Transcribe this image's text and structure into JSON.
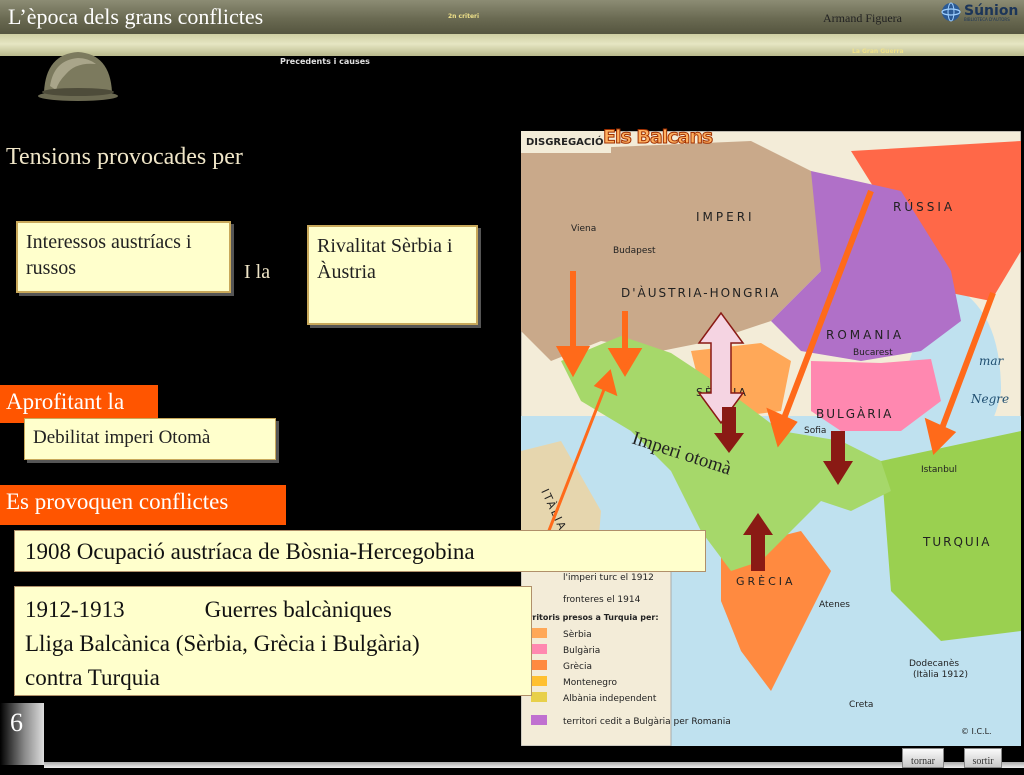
{
  "header": {
    "title": "L’època dels grans conflictes",
    "tiny_top": "2n criteri",
    "author": "Armand Figuera",
    "logo_text": "Súnion",
    "logo_sub": "BIBLIOTECA D'AUTORS",
    "subtitle": "Precedents i causes",
    "subtitle_right": "La Gran Guerra"
  },
  "main": {
    "heading": "Tensions provocades per",
    "box_interests": "Interessos austríacs i russos",
    "connector": "I la",
    "box_rivalry": "Rivalitat Sèrbia i Àustria",
    "tag_profit": "Aprofitant la",
    "box_weakness": "Debilitat imperi Otomà",
    "tag_conflicts": "Es provoquen conflictes",
    "event_1908": "1908 Ocupació austríaca de Bòsnia-Hercegobina",
    "event_1912_years": "1912-1913",
    "event_1912_title": "Guerres balcàniques",
    "event_1912_line2": "Lliga Balcànica (Sèrbia, Grècia i Bulgària)",
    "event_1912_line3": "contra Turquia"
  },
  "map": {
    "title": "Els Balcans",
    "header_label": "DISGREGACIÓ",
    "labels": {
      "imperi": "IMPERI",
      "austria": "D'ÀUSTRIA-HONGRIA",
      "russia": "RÚSSIA",
      "romania": "ROMANIA",
      "serbia": "SÈRBIA",
      "bulgaria": "BULGÀRIA",
      "grecia": "GRÈCIA",
      "turquia": "TURQUIA",
      "italia": "ITÀLIA",
      "viena": "Viena",
      "budapest": "Budapest",
      "bucarest": "Bucarest",
      "sofia": "Sofia",
      "istanbul": "Istanbul",
      "atenes": "Atenes",
      "creta": "Creta",
      "dodecanes": "Dodecanès",
      "italia1912": "(Itàlia 1912)",
      "mar": "mar",
      "negre": "Negre",
      "ottoman_overlay": "Imperi otomà"
    },
    "legend": {
      "title_a": "l'imperi turc el 1912",
      "title_b": "fronteres el 1914",
      "title_c": "erritoris presos a Turquia per:",
      "items": [
        "Sèrbia",
        "Bulgària",
        "Grècia",
        "Montenegro",
        "Albània independent"
      ],
      "last": "territori cedit a Bulgària per Romania",
      "copyright": "© I.C.L."
    }
  },
  "footer": {
    "page_number": "6",
    "back_label": "tornar",
    "exit_label": "sortir"
  },
  "colors": {
    "accent_orange": "#ff5500",
    "box_fill": "#ffffcc",
    "ottoman_green": "#a6d86a",
    "arrow_dark_red": "#8a1a14",
    "arrow_orange": "#ff6a1a"
  }
}
